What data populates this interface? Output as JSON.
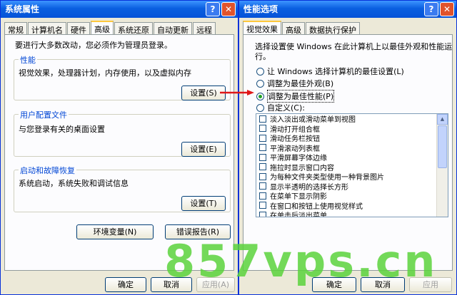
{
  "sys": {
    "title": "系统属性",
    "tabs": [
      "常规",
      "计算机名",
      "硬件",
      "高级",
      "系统还原",
      "自动更新",
      "远程"
    ],
    "intro": "要进行大多数改动，您必须作为管理员登录。",
    "perf": {
      "label": "性能",
      "desc": "视觉效果，处理器计划，内存使用，以及虚拟内存",
      "button": "设置(S)"
    },
    "profile": {
      "label": "用户配置文件",
      "desc": "与您登录有关的桌面设置",
      "button": "设置(E)"
    },
    "startup": {
      "label": "启动和故障恢复",
      "desc": "系统启动，系统失败和调试信息",
      "button": "设置(T)"
    },
    "env_button": "环境变量(N)",
    "err_button": "错误报告(R)",
    "ok": "确定",
    "cancel": "取消",
    "apply": "应用(A)"
  },
  "perf_win": {
    "title": "性能选项",
    "tabs": [
      "视觉效果",
      "高级",
      "数据执行保护"
    ],
    "intro_line1": "选择设置使 Windows 在此计算机上以最佳外观和性能运",
    "intro_line2": "行。",
    "radios": [
      "让 Windows 选择计算机的最佳设置(L)",
      "调整为最佳外观(B)",
      "调整为最佳性能(P)",
      "自定义(C):"
    ],
    "selected_radio": 2,
    "items": [
      "淡入淡出或滑动菜单到视图",
      "滑动打开组合框",
      "滑动任务栏按钮",
      "平滑滚动列表框",
      "平滑屏幕字体边缘",
      "拖拉时显示窗口内容",
      "为每种文件夹类型使用一种背景图片",
      "显示半透明的选择长方形",
      "在菜单下显示阴影",
      "在窗口和按钮上使用视觉样式",
      "在单击后淡出菜单"
    ],
    "ok": "确定",
    "cancel": "取消",
    "apply": "应用"
  },
  "watermark": "857vps.cn",
  "colors": {
    "title_bar": "#0a5fe0",
    "group_label": "#0046d5",
    "arrow": "#e01818",
    "watermark": "#5ad23c"
  }
}
